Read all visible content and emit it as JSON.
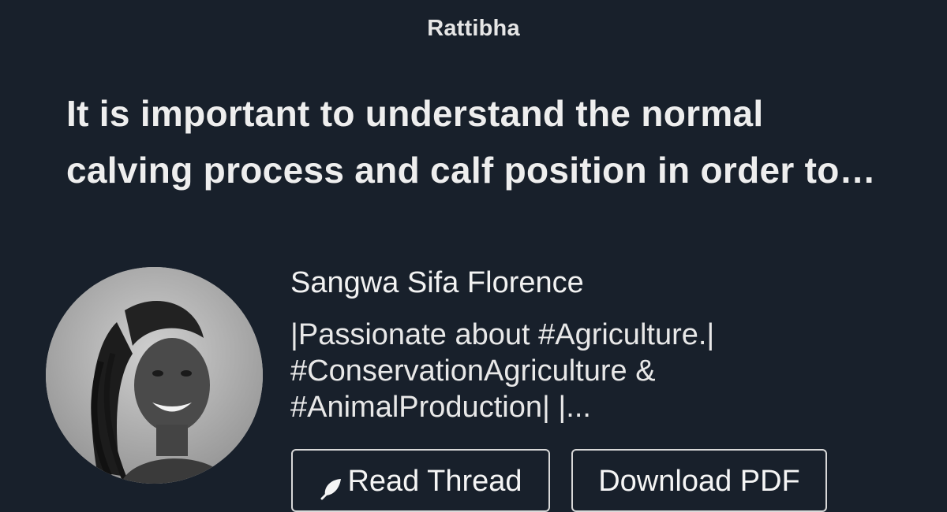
{
  "brand": {
    "name": "Rattibha"
  },
  "thread": {
    "title_line_1": "It is important to understand the normal",
    "title_line_2": "calving process and calf position in order to…"
  },
  "author": {
    "name": "Sangwa Sifa Florence",
    "bio_line_1": "|Passionate about #Agriculture.|",
    "bio_line_2": "#ConservationAgriculture &",
    "bio_line_3": "#AnimalProduction| |..."
  },
  "actions": {
    "read_label": "Read Thread",
    "read_icon": "feather-icon",
    "pdf_label": "Download PDF"
  },
  "colors": {
    "background": "#18202b",
    "text": "#f2f2f2",
    "button_border": "#d8d8d8"
  }
}
